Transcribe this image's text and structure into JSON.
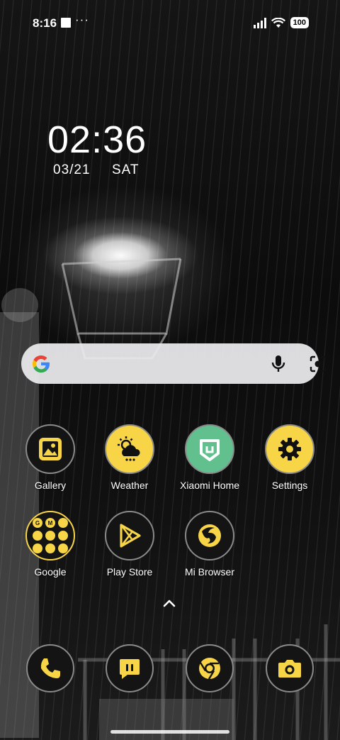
{
  "status_bar": {
    "time": "8:16",
    "extra_icons": "···",
    "battery": "100"
  },
  "clock": {
    "time": "02:36",
    "date": "03/21",
    "day": "SAT"
  },
  "search": {
    "icons": [
      "google-logo",
      "mic-icon",
      "lens-icon"
    ]
  },
  "apps": [
    {
      "label": "Gallery",
      "icon": "gallery-icon"
    },
    {
      "label": "Weather",
      "icon": "weather-icon"
    },
    {
      "label": "Xiaomi Home",
      "icon": "xiaomi-home-icon"
    },
    {
      "label": "Settings",
      "icon": "settings-icon"
    },
    {
      "label": "Google",
      "icon": "google-folder-icon"
    },
    {
      "label": "Play Store",
      "icon": "play-store-icon"
    },
    {
      "label": "Mi Browser",
      "icon": "mi-browser-icon"
    }
  ],
  "folder_letters": [
    "G",
    "M",
    "",
    "",
    "",
    "",
    "",
    "",
    ""
  ],
  "dock": [
    {
      "icon": "phone-icon"
    },
    {
      "icon": "messages-icon"
    },
    {
      "icon": "chrome-icon"
    },
    {
      "icon": "camera-icon"
    }
  ],
  "colors": {
    "accent_yellow": "#f7d547",
    "xiaomi_green": "#62c08e",
    "icon_dark": "#141414"
  }
}
